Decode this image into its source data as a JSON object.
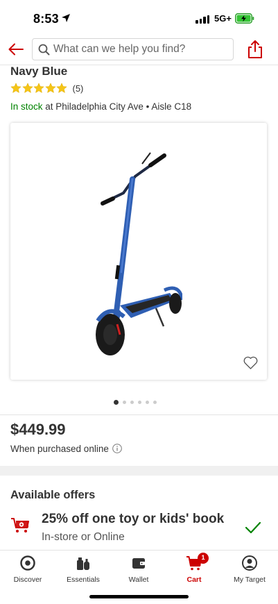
{
  "status_bar": {
    "time": "8:53",
    "network": "5G+"
  },
  "search": {
    "placeholder": "What can we help you find?"
  },
  "product": {
    "variant": "Navy Blue",
    "rating": 5,
    "review_count": "(5)",
    "stock_status": "In stock",
    "stock_location": " at Philadelphia City Ave • Aisle C18",
    "price": "$449.99",
    "price_note": "When purchased online",
    "image_count": 6,
    "current_image": 1
  },
  "offers": {
    "title": "Available offers",
    "items": [
      {
        "title": "25% off one toy or kids' book",
        "subtitle": "In-store or Online"
      }
    ]
  },
  "tabbar": {
    "items": [
      {
        "label": "Discover",
        "icon": "target-logo-icon"
      },
      {
        "label": "Essentials",
        "icon": "essentials-icon"
      },
      {
        "label": "Wallet",
        "icon": "wallet-icon"
      },
      {
        "label": "Cart",
        "icon": "cart-icon",
        "badge": "1",
        "active": true
      },
      {
        "label": "My Target",
        "icon": "profile-icon"
      }
    ]
  },
  "colors": {
    "brand_red": "#cc0000",
    "in_stock_green": "#008300",
    "check_green": "#008300"
  }
}
